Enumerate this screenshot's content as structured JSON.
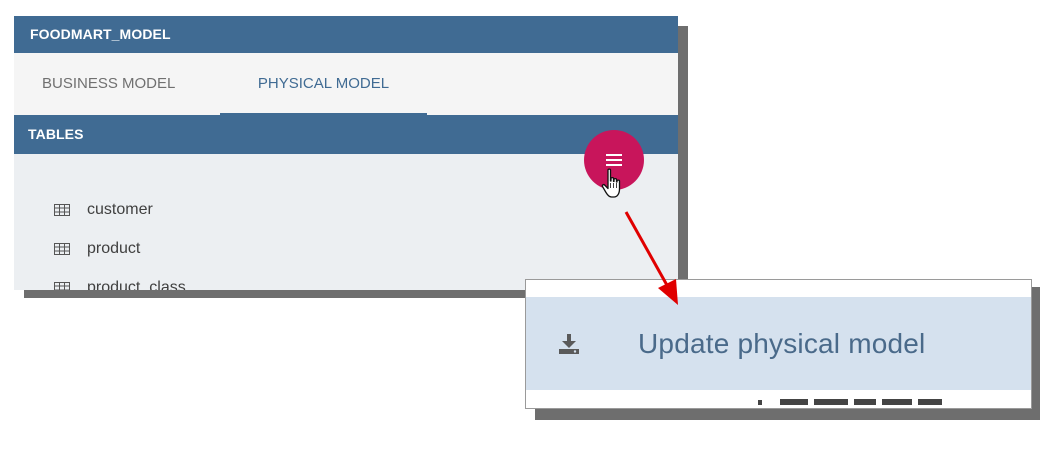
{
  "panel": {
    "title": "FOODMART_MODEL",
    "tabs": [
      {
        "label": "BUSINESS MODEL",
        "active": false
      },
      {
        "label": "PHYSICAL MODEL",
        "active": true
      }
    ],
    "tables_header": "TABLES",
    "tables": [
      {
        "name": "customer",
        "icon": "table-grid-icon"
      },
      {
        "name": "product",
        "icon": "table-grid-icon"
      },
      {
        "name": "product_class",
        "icon": "table-grid-icon"
      }
    ]
  },
  "fab": {
    "icon": "menu-icon",
    "cursor": "hand-pointer-icon"
  },
  "menu": {
    "items": [
      {
        "label": "Update physical model",
        "icon": "download-icon"
      }
    ]
  },
  "colors": {
    "header_blue": "#406b93",
    "fab_pink": "#c8155b",
    "arrow_red": "#e00000",
    "menu_highlight": "#d5e1ee"
  }
}
